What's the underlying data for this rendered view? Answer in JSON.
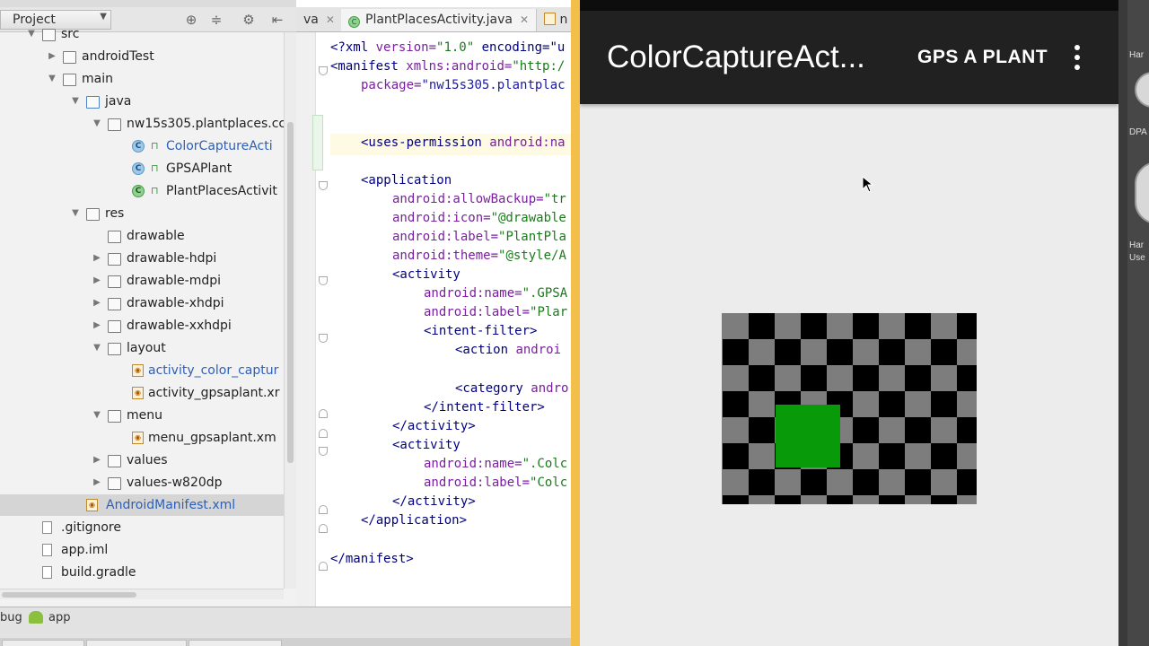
{
  "project_panel": {
    "dropdown_label": "Project",
    "toolbar_icons": [
      "target-icon",
      "collapse-icon",
      "gear-icon",
      "hide-icon"
    ],
    "tree": [
      {
        "label": "src",
        "kind": "folder"
      },
      {
        "label": "androidTest",
        "kind": "folder"
      },
      {
        "label": "main",
        "kind": "folder"
      },
      {
        "label": "java",
        "kind": "folder-blue"
      },
      {
        "label": "nw15s305.plantplaces.cc",
        "kind": "package"
      },
      {
        "label": "ColorCaptureActi",
        "kind": "class"
      },
      {
        "label": "GPSAPlant",
        "kind": "class"
      },
      {
        "label": "PlantPlacesActivit",
        "kind": "class-green"
      },
      {
        "label": "res",
        "kind": "folder"
      },
      {
        "label": "drawable",
        "kind": "folder"
      },
      {
        "label": "drawable-hdpi",
        "kind": "folder"
      },
      {
        "label": "drawable-mdpi",
        "kind": "folder"
      },
      {
        "label": "drawable-xhdpi",
        "kind": "folder"
      },
      {
        "label": "drawable-xxhdpi",
        "kind": "folder"
      },
      {
        "label": "layout",
        "kind": "folder"
      },
      {
        "label": "activity_color_captur",
        "kind": "xml"
      },
      {
        "label": "activity_gpsaplant.xr",
        "kind": "xml"
      },
      {
        "label": "menu",
        "kind": "folder"
      },
      {
        "label": "menu_gpsaplant.xm",
        "kind": "xml"
      },
      {
        "label": "values",
        "kind": "folder"
      },
      {
        "label": "values-w820dp",
        "kind": "folder"
      },
      {
        "label": "AndroidManifest.xml",
        "kind": "xml"
      },
      {
        "label": ".gitignore",
        "kind": "file"
      },
      {
        "label": "app.iml",
        "kind": "file"
      },
      {
        "label": "build.gradle",
        "kind": "file"
      }
    ]
  },
  "editor_tabs": [
    {
      "label": "va"
    },
    {
      "label": "PlantPlacesActivity.java"
    },
    {
      "label": "n"
    }
  ],
  "code_lines": [
    {
      "tag": "<?xml ",
      "attr": "version=",
      "val": "\"1.0\"",
      "rest": " encoding=\"u"
    },
    {
      "tag": "<manifest ",
      "attr": "xmlns:android=",
      "val": "\"http:/",
      "rest": ""
    },
    {
      "tag": "",
      "attr": "package=",
      "val": "\"nw15s305.plantplac",
      "rest": ""
    },
    {
      "tag": "<uses-permission ",
      "attr": "android:na",
      "val": "",
      "rest": ""
    },
    {
      "tag": "<application",
      "attr": "",
      "val": "",
      "rest": ""
    },
    {
      "tag": "",
      "attr": "android:allowBackup=",
      "val": "\"tr",
      "rest": ""
    },
    {
      "tag": "",
      "attr": "android:icon=",
      "val": "\"@drawable",
      "rest": ""
    },
    {
      "tag": "",
      "attr": "android:label=",
      "val": "\"PlantPla",
      "rest": ""
    },
    {
      "tag": "",
      "attr": "android:theme=",
      "val": "\"@style/A",
      "rest": ""
    },
    {
      "tag": "<activity",
      "attr": "",
      "val": "",
      "rest": ""
    },
    {
      "tag": "",
      "attr": "android:name=",
      "val": "\".GPSA",
      "rest": ""
    },
    {
      "tag": "",
      "attr": "android:label=",
      "val": "\"Plar",
      "rest": ""
    },
    {
      "tag": "<intent-filter>",
      "attr": "",
      "val": "",
      "rest": ""
    },
    {
      "tag": "<action ",
      "attr": "androi",
      "val": "",
      "rest": ""
    },
    {
      "tag": "<category ",
      "attr": "andro",
      "val": "",
      "rest": ""
    },
    {
      "tag": "</intent-filter>",
      "attr": "",
      "val": "",
      "rest": ""
    },
    {
      "tag": "</activity>",
      "attr": "",
      "val": "",
      "rest": ""
    },
    {
      "tag": "<activity",
      "attr": "",
      "val": "",
      "rest": ""
    },
    {
      "tag": "",
      "attr": "android:name=",
      "val": "\".Colc",
      "rest": ""
    },
    {
      "tag": "",
      "attr": "android:label=",
      "val": "\"Colc",
      "rest": ""
    },
    {
      "tag": "</activity>",
      "attr": "",
      "val": "",
      "rest": ""
    },
    {
      "tag": "</application>",
      "attr": "",
      "val": "",
      "rest": ""
    },
    {
      "tag": "</manifest>",
      "attr": "",
      "val": "",
      "rest": ""
    }
  ],
  "bottom_bar": {
    "debug_label": "bug",
    "app_label": "app"
  },
  "emulator": {
    "app_title": "ColorCaptureAct...",
    "action_button": "GPS A PLANT",
    "overflow_icon": "more-vert-icon",
    "accent_green": "#089a08",
    "action_bar_color": "#212121"
  },
  "side_panel": {
    "labels": [
      "Har",
      "DPA",
      "Har",
      "Use"
    ]
  }
}
